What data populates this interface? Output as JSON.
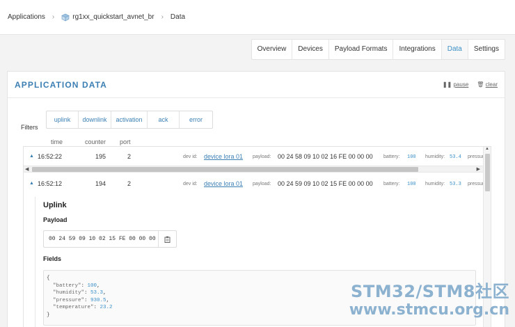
{
  "breadcrumb": {
    "root": "Applications",
    "app": "rg1xx_quickstart_avnet_br",
    "current": "Data"
  },
  "tabs": [
    {
      "label": "Overview",
      "active": false
    },
    {
      "label": "Devices",
      "active": false
    },
    {
      "label": "Payload Formats",
      "active": false
    },
    {
      "label": "Integrations",
      "active": false
    },
    {
      "label": "Data",
      "active": true
    },
    {
      "label": "Settings",
      "active": false
    }
  ],
  "panel": {
    "title": "APPLICATION DATA",
    "pause_label": "pause",
    "clear_label": "clear"
  },
  "filters": {
    "label": "Filters",
    "items": [
      "uplink",
      "downlink",
      "activation",
      "ack",
      "error"
    ]
  },
  "columns": {
    "time": "time",
    "counter": "counter",
    "port": "port"
  },
  "messages": [
    {
      "time": "16:52:22",
      "counter": "195",
      "port": "2",
      "dev_id_label": "dev id:",
      "dev_id": "device lora 01",
      "payload_label": "payload:",
      "payload": "00 24 58 09 10 02 16 FE 00 00 00",
      "battery_label": "battery:",
      "battery": "100",
      "humidity_label": "humidity:",
      "humidity": "53.4",
      "pressure_label": "pressure"
    },
    {
      "time": "16:52:12",
      "counter": "194",
      "port": "2",
      "dev_id_label": "dev id:",
      "dev_id": "device lora 01",
      "payload_label": "payload:",
      "payload": "00 24 59 09 10 02 15 FE 00 00 00",
      "battery_label": "battery:",
      "battery": "100",
      "humidity_label": "humidity:",
      "humidity": "53.3",
      "pressure_label": "pressure"
    }
  ],
  "detail": {
    "title": "Uplink",
    "payload_label": "Payload",
    "payload_hex": "00 24 59 09 10 02 15 FE 00 00 00",
    "fields_label": "Fields",
    "fields": {
      "battery": "100",
      "humidity": "53.3",
      "pressure": "930.5",
      "temperature": "23.2"
    }
  },
  "watermark": {
    "line1": "STM32/STM8社区",
    "line2": "www.stmcu.org.cn"
  },
  "colors": {
    "accent": "#3b7fb3",
    "value": "#3b8fc6"
  }
}
